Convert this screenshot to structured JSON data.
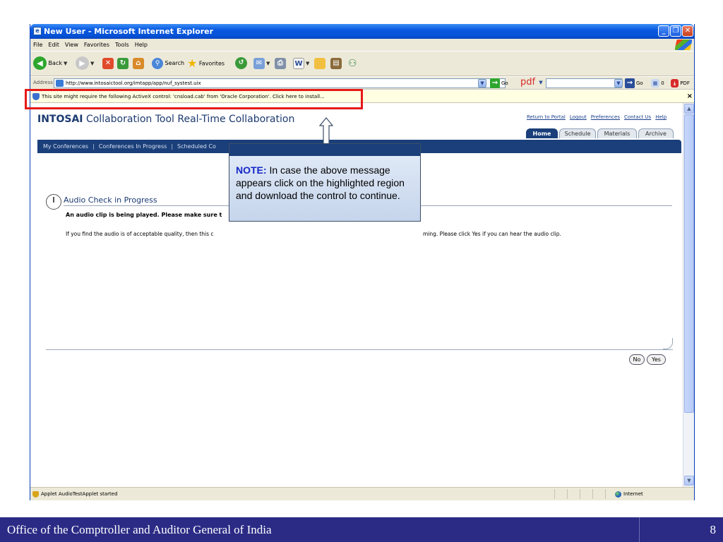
{
  "window": {
    "title": "New User - Microsoft Internet Explorer",
    "min_glyph": "_",
    "max_glyph": "❐",
    "close_glyph": "✕"
  },
  "menubar": [
    "File",
    "Edit",
    "View",
    "Favorites",
    "Tools",
    "Help"
  ],
  "toolbar": {
    "back": "Back",
    "search": "Search",
    "favorites": "Favorites"
  },
  "addressbar": {
    "label": "Address",
    "url": "http://www.intosaictool.org/imtapp/app/nuf_systest.uix",
    "go": "Go",
    "pdf_logo": "pdf",
    "go2": "Go",
    "count": "0",
    "pdf_label": "PDF"
  },
  "infobar": {
    "message": "This site might require the following ActiveX control: 'cnsload.cab' from 'Oracle Corporation'. Click here to install...",
    "close": "×"
  },
  "app": {
    "brand": "INTOSAI",
    "title": "Collaboration Tool Real-Time Collaboration",
    "global_links": [
      "Return to Portal",
      "Logout",
      "Preferences",
      "Contact Us",
      "Help"
    ],
    "tabs": [
      "Home",
      "Schedule",
      "Materials",
      "Archive"
    ],
    "nav": [
      "My Conferences",
      "Conferences In Progress",
      "Scheduled Co"
    ],
    "section_title": "Audio Check in Progress",
    "bold_line": "An audio clip is being played. Please make sure t",
    "body_line_left": "If you find the audio is of acceptable quality, then this c",
    "body_line_right": "ming. Please click Yes if you can hear the audio clip.",
    "buttons": {
      "no": "No",
      "yes": "Yes"
    }
  },
  "status": {
    "text": "Applet AudioTestApplet started",
    "zone": "Internet"
  },
  "callout": {
    "note_label": "NOTE:",
    "text": " In case the above message appears click on the highlighted region and download the control to continue."
  },
  "footer": {
    "title": "Office of the Comptroller and Auditor General of India",
    "page": "8"
  },
  "colors": {
    "highlight": "#e61919",
    "footer_bg": "#2b2b86",
    "nav_bg": "#1a3f7a",
    "note_blue": "#1426c8"
  }
}
